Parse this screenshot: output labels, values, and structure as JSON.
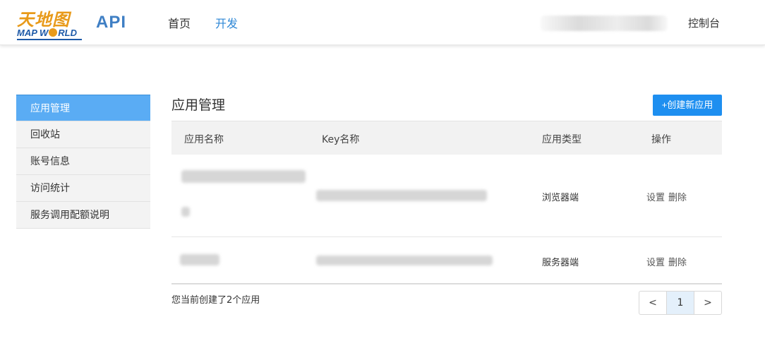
{
  "header": {
    "logo_cn": "天地图",
    "logo_en_part1": "MAP W",
    "logo_en_part2": "RLD",
    "api_label": "API",
    "nav": {
      "home": "首页",
      "develop": "开发"
    },
    "console": "控制台"
  },
  "sidebar": {
    "items": [
      {
        "label": "应用管理",
        "active": true
      },
      {
        "label": "回收站"
      },
      {
        "label": "账号信息"
      },
      {
        "label": "访问统计"
      },
      {
        "label": "服务调用配额说明"
      }
    ]
  },
  "main": {
    "title": "应用管理",
    "create_button": "+创建新应用",
    "table": {
      "headers": [
        "应用名称",
        "Key名称",
        "应用类型",
        "操作"
      ],
      "rows": [
        {
          "type": "浏览器端",
          "actions": [
            "设置",
            "删除"
          ]
        },
        {
          "type": "服务器端",
          "actions": [
            "设置",
            "删除"
          ]
        }
      ]
    },
    "count_text": "您当前创建了2个应用",
    "pagination": {
      "prev": "<",
      "current": "1",
      "next": ">"
    }
  },
  "colors": {
    "accent": "#1e8ff0",
    "sidebar_active": "#5aacf4",
    "logo_orange": "#e89a1a",
    "logo_blue": "#1e5aa8"
  }
}
